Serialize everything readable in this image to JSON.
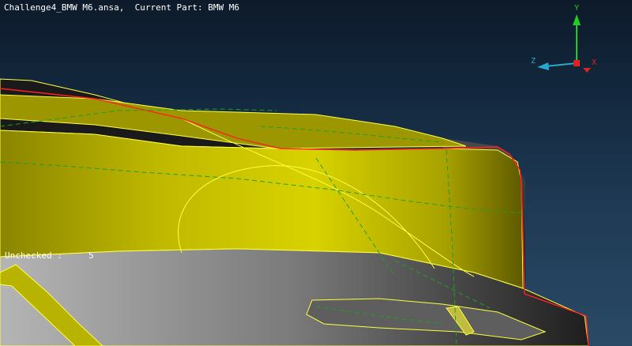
{
  "viewport": {
    "filename": "Challenge4_BMW M6.ansa,",
    "current_part_label": "Current Part:",
    "current_part_name": "BMW M6",
    "status_label": "Unchecked :",
    "status_value": "5"
  },
  "triad": {
    "y_label": "Y",
    "z_label": "Z",
    "x_label": "X",
    "colors": {
      "y": "#22cc22",
      "z": "#2aa6c8",
      "x": "#dd2222"
    }
  },
  "colors": {
    "surface_yellow": "#c8c200",
    "surface_gray": "#9a9a9a",
    "edge_red": "#ff2020",
    "edge_yellow": "#ffff40",
    "feature_green": "#20a020"
  }
}
